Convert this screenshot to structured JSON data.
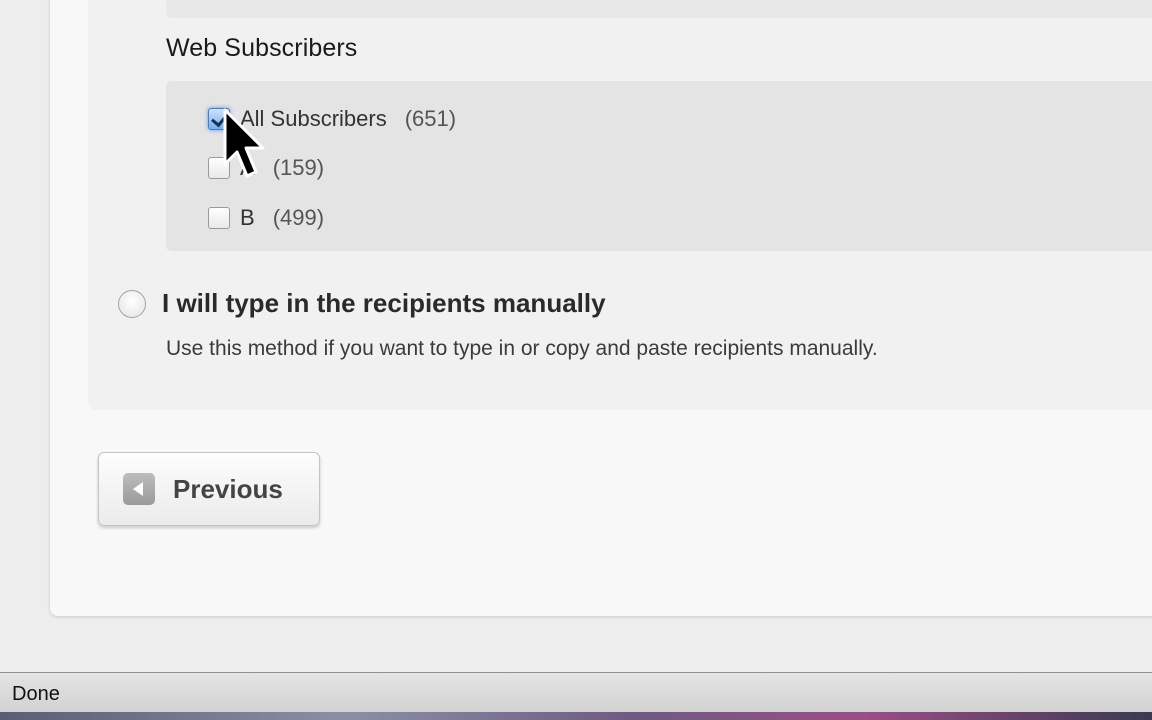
{
  "web_subscribers": {
    "title": "Web Subscribers",
    "items": [
      {
        "label": "All Subscribers",
        "count": "(651)",
        "checked": true
      },
      {
        "label": "A",
        "count": "(159)",
        "checked": false
      },
      {
        "label": "B",
        "count": "(499)",
        "checked": false
      }
    ]
  },
  "manual_option": {
    "label": "I will type in the recipients manually",
    "help": "Use this method if you want to type in or copy and paste recipients manually.",
    "selected": false
  },
  "navigation": {
    "previous_label": "Previous"
  },
  "status_bar": {
    "text": "Done"
  },
  "icons": {
    "previous": "arrow-left-icon",
    "cursor": "mouse-pointer-icon"
  },
  "colors": {
    "checkbox_checked": "#7aaeea",
    "status_bar": "#d2d2d2"
  }
}
